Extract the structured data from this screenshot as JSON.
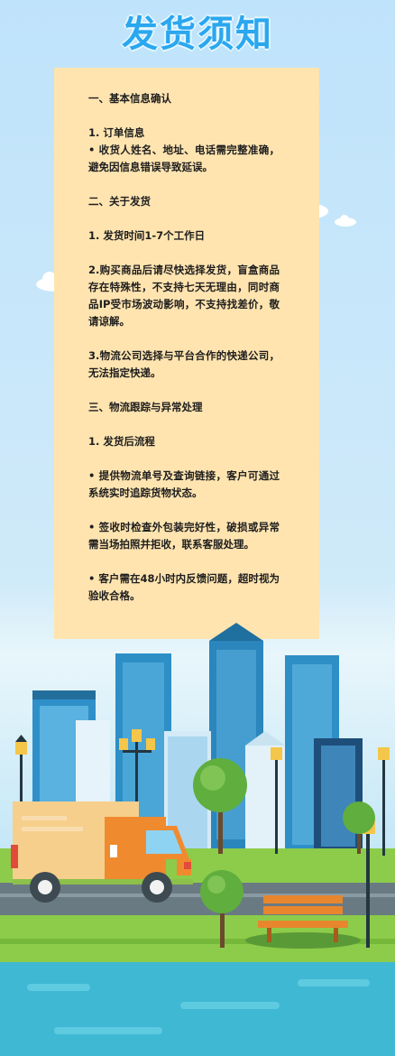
{
  "title": "发货须知",
  "sections": {
    "s1_heading": "一、基本信息确认",
    "s1_item1_title": "1. 订单信息",
    "s1_item1_body": "• 收货人姓名、地址、电话需完整准确，避免因信息错误导致延误。",
    "s2_heading": "二、关于发货",
    "s2_item1": "1. 发货时间1-7个工作日",
    "s2_item2": "2.购买商品后请尽快选择发货，盲盒商品存在特殊性，不支持七天无理由，同时商品IP受市场波动影响，不支持找差价，敬请谅解。",
    "s2_item3": "3.物流公司选择与平台合作的快递公司，无法指定快递。",
    "s3_heading": "三、物流跟踪与异常处理",
    "s3_item1_title": "1. 发货后流程",
    "s3_bullet1": "• 提供物流单号及查询链接，客户可通过系统实时追踪货物状态。",
    "s3_bullet2": "• 签收时检查外包装完好性，破损或异常需当场拍照并拒收，联系客服处理。",
    "s3_bullet3": "• 客户需在48小时内反馈问题，超时视为验收合格。"
  },
  "colors": {
    "title": "#2aa7ef",
    "card": "#ffe4b0",
    "sky": "#cfeaf9",
    "river": "#3fb8d4",
    "grass": "#8ccc4a",
    "road": "#6a7a82"
  },
  "illustration": {
    "icons": [
      "cloud-icon",
      "building-icon",
      "tree-icon",
      "street-lamp-icon",
      "delivery-truck-icon",
      "bench-icon"
    ]
  }
}
